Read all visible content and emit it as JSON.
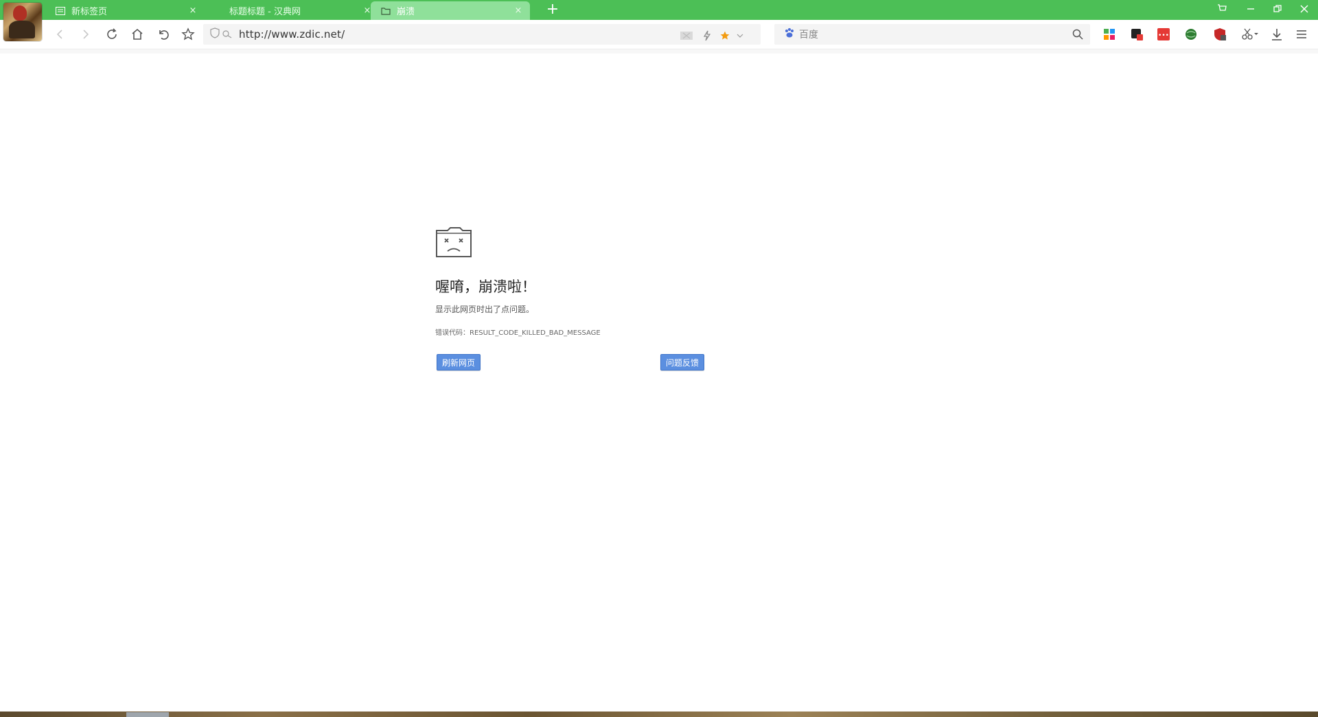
{
  "tabs": [
    {
      "title": "新标签页",
      "icon": "grid-page-icon",
      "active": false
    },
    {
      "title": "标题标题 - 汉典网",
      "icon": "",
      "active": false
    },
    {
      "title": "崩溃",
      "icon": "folder-icon",
      "active": true
    }
  ],
  "toolbar": {
    "url": "http://www.zdic.net/",
    "search_engine": "百度"
  },
  "crash": {
    "title": "喔唷，崩溃啦！",
    "description": "显示此网页时出了点问题。",
    "error_code": "错误代码：RESULT_CODE_KILLED_BAD_MESSAGE",
    "reload_label": "刷新网页",
    "feedback_label": "问题反馈"
  },
  "colors": {
    "tabstrip": "#4cbf56",
    "active_tab": "#8fe09a",
    "button": "#5b8fe0"
  }
}
